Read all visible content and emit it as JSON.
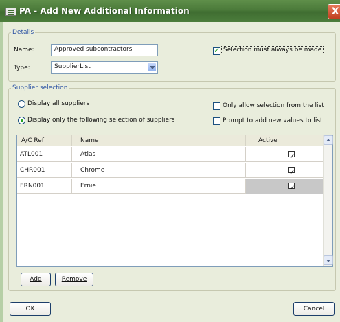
{
  "window": {
    "title": "PA - Add New Additional Information",
    "close_glyph": "X"
  },
  "details": {
    "group_label": "Details",
    "name_label": "Name:",
    "name_value": "Approved subcontractors",
    "type_label": "Type:",
    "type_value": "SupplierList",
    "must_select_label": "Selection must always be made",
    "must_select_checked": true
  },
  "supplier_selection": {
    "group_label": "Supplier selection",
    "radio_all_label": "Display all suppliers",
    "radio_selection_label": "Display only the following selection of suppliers",
    "only_allow_label": "Only allow selection from the list",
    "prompt_add_label": "Prompt to add new values to list"
  },
  "grid": {
    "columns": [
      "A/C Ref",
      "Name",
      "Active"
    ],
    "rows": [
      {
        "ref": "ATL001",
        "name": "Atlas",
        "active": true
      },
      {
        "ref": "CHR001",
        "name": "Chrome",
        "active": true
      },
      {
        "ref": "ERN001",
        "name": "Ernie",
        "active": true
      }
    ]
  },
  "buttons": {
    "add": "Add",
    "remove": "Remove",
    "ok": "OK",
    "cancel": "Cancel"
  }
}
